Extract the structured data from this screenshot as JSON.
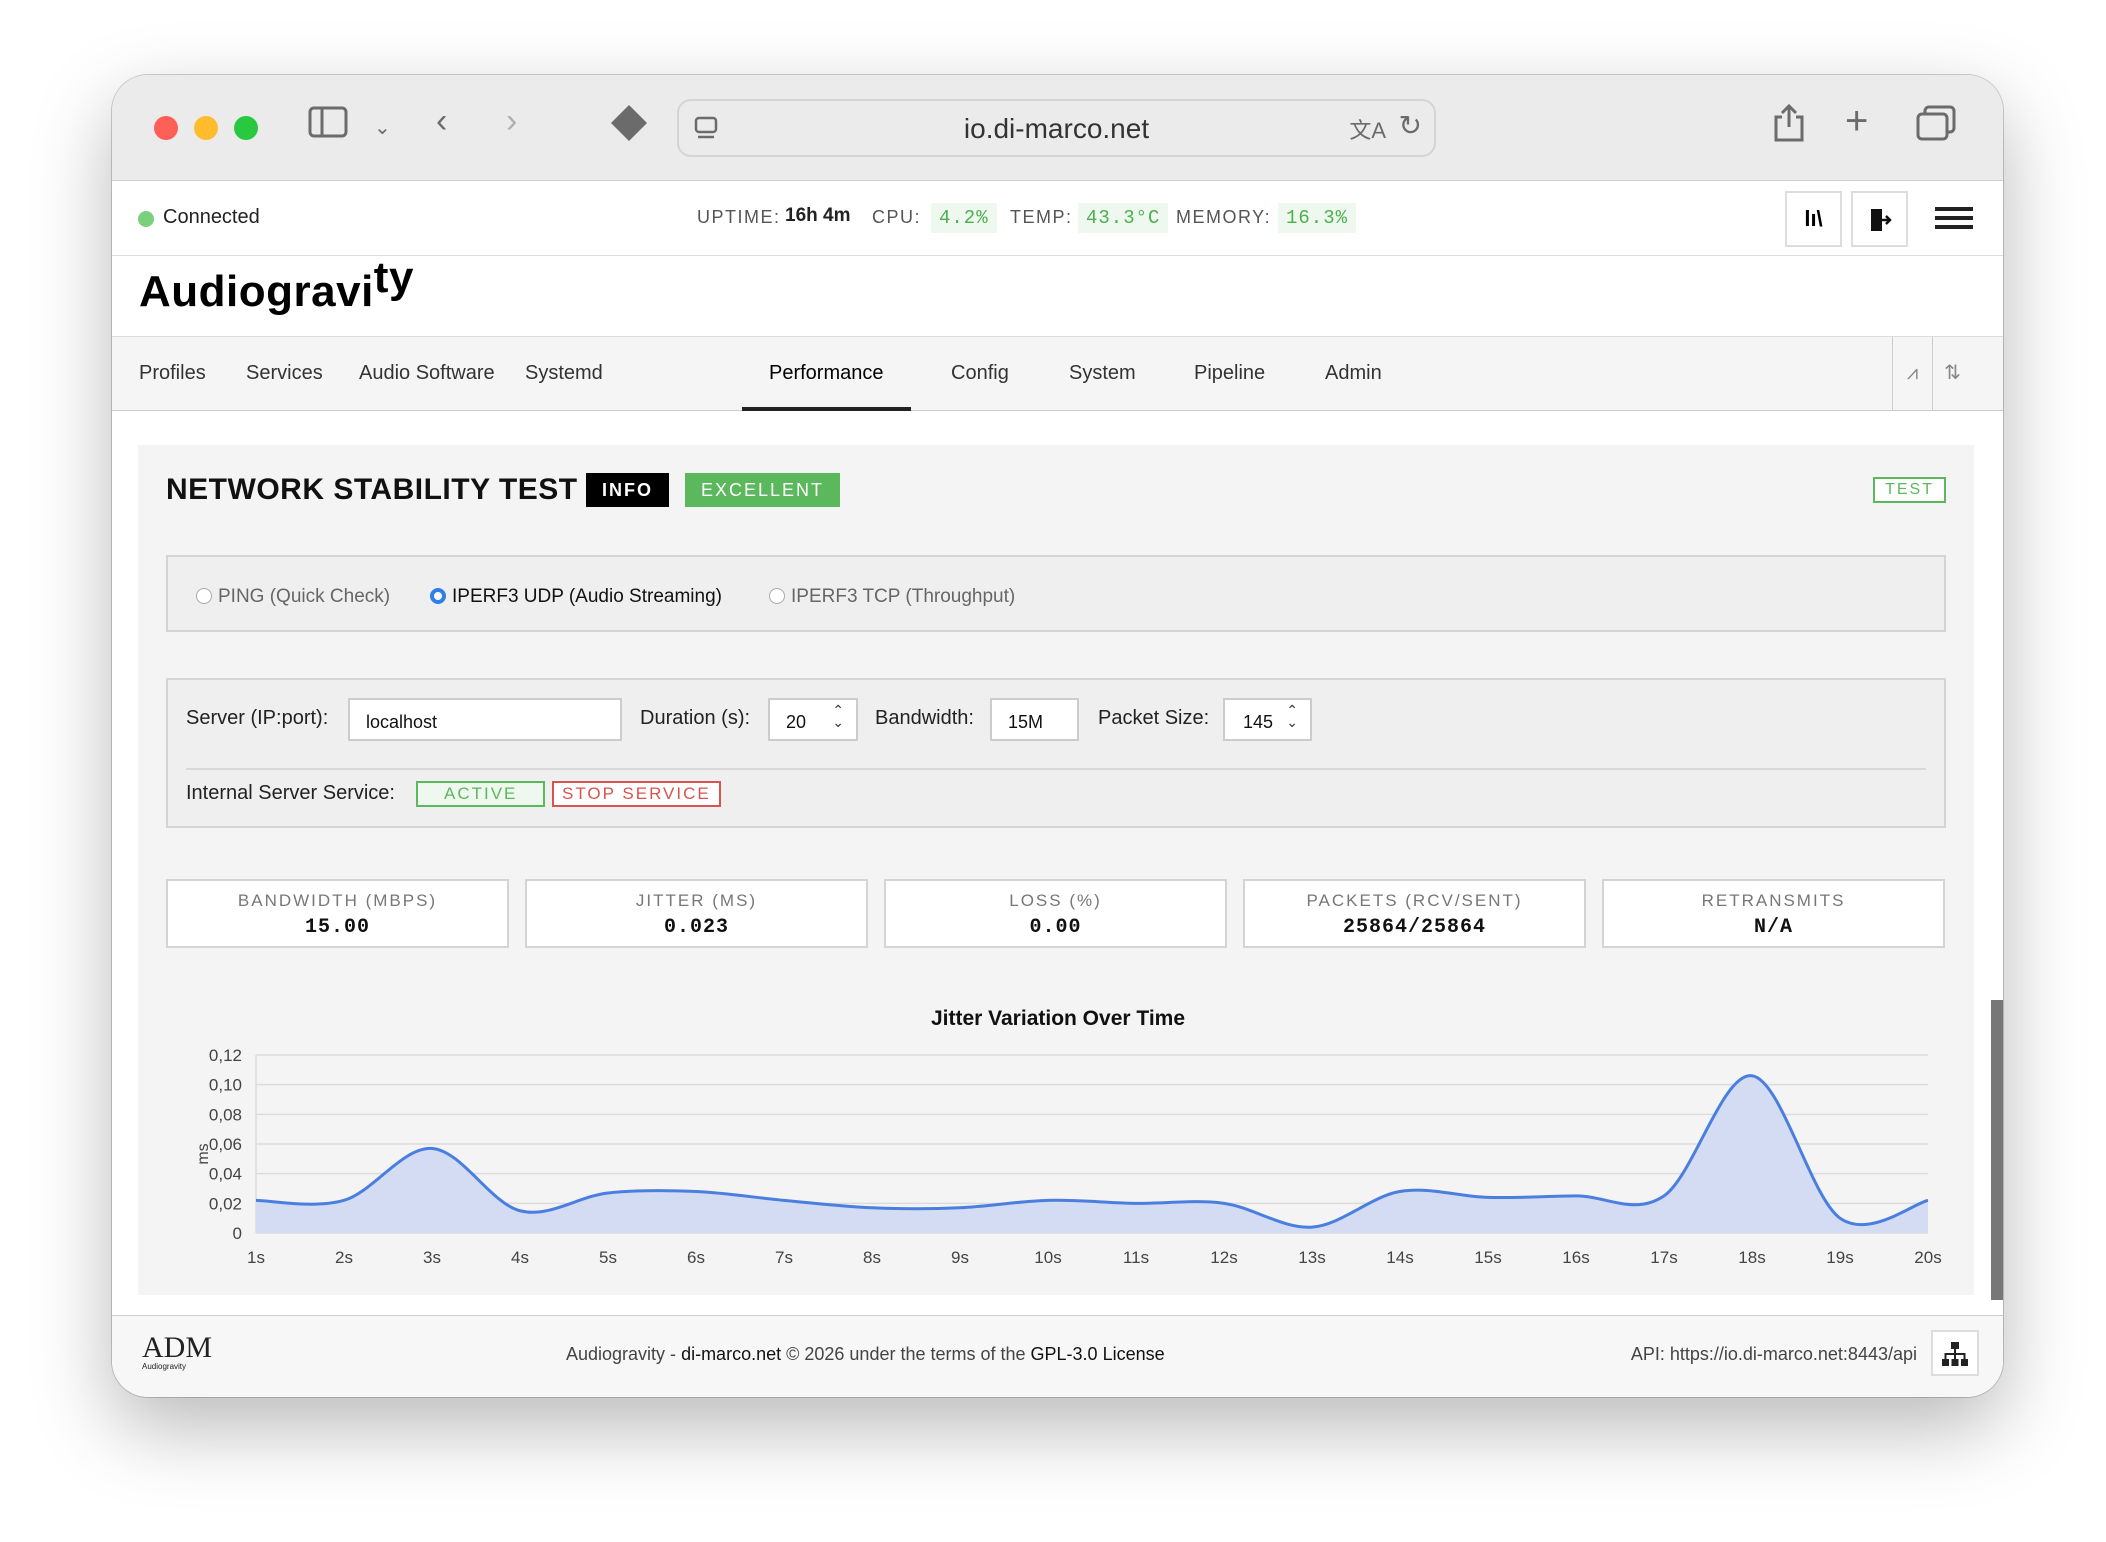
{
  "browser": {
    "url": "io.di-marco.net"
  },
  "status": {
    "connection": "Connected",
    "uptime_label": "UPTIME:",
    "uptime": "16h 4m",
    "cpu_label": "CPU:",
    "cpu": "4.2%",
    "temp_label": "TEMP:",
    "temp": "43.3°C",
    "memory_label": "MEMORY:",
    "memory": "16.3%",
    "color_ok": "#4caf50"
  },
  "brand": {
    "main": "Audiogravi",
    "sup": "ty"
  },
  "nav": {
    "tabs": [
      "Profiles",
      "Services",
      "Audio Software",
      "Systemd",
      "Performance",
      "Config",
      "System",
      "Pipeline",
      "Admin"
    ],
    "active": "Performance"
  },
  "test": {
    "title": "NETWORK STABILITY TEST",
    "info_badge": "INFO",
    "quality_badge": "EXCELLENT",
    "test_button": "TEST"
  },
  "modes": {
    "options": [
      "PING (Quick Check)",
      "IPERF3 UDP (Audio Streaming)",
      "IPERF3 TCP (Throughput)"
    ],
    "selected": "IPERF3 UDP (Audio Streaming)"
  },
  "settings": {
    "server_label": "Server (IP:port):",
    "server_value": "localhost",
    "duration_label": "Duration (s):",
    "duration_value": "20",
    "bandwidth_label": "Bandwidth:",
    "bandwidth_value": "15M",
    "packet_label": "Packet Size:",
    "packet_value": "145",
    "service_label": "Internal Server Service:",
    "service_status": "ACTIVE",
    "stop_label": "STOP SERVICE"
  },
  "metrics": [
    {
      "label": "BANDWIDTH (MBPS)",
      "value": "15.00"
    },
    {
      "label": "JITTER (MS)",
      "value": "0.023"
    },
    {
      "label": "LOSS (%)",
      "value": "0.00"
    },
    {
      "label": "PACKETS (RCV/SENT)",
      "value": "25864/25864"
    },
    {
      "label": "RETRANSMITS",
      "value": "N/A"
    }
  ],
  "chart_data": {
    "type": "area",
    "title": "Jitter Variation Over Time",
    "ylabel": "ms",
    "x": [
      "1s",
      "2s",
      "3s",
      "4s",
      "5s",
      "6s",
      "7s",
      "8s",
      "9s",
      "10s",
      "11s",
      "12s",
      "13s",
      "14s",
      "15s",
      "16s",
      "17s",
      "18s",
      "19s",
      "20s"
    ],
    "values": [
      0.022,
      0.022,
      0.057,
      0.015,
      0.027,
      0.028,
      0.022,
      0.017,
      0.017,
      0.022,
      0.02,
      0.02,
      0.004,
      0.028,
      0.024,
      0.025,
      0.025,
      0.106,
      0.01,
      0.022
    ],
    "ylim": [
      0,
      0.12
    ],
    "yticks": [
      "0",
      "0,02",
      "0,04",
      "0,06",
      "0,08",
      "0,10",
      "0,12"
    ],
    "line_color": "#4a7fe0",
    "fill_color": "#d3dcf3",
    "grid": true
  },
  "footer": {
    "logo": "ADM",
    "logo_sub": "Audiogravity",
    "text1": "Audiogravity - ",
    "link1": "di-marco.net",
    "text2": " © 2026 under the terms of the ",
    "link2": "GPL-3.0 License",
    "api": "API: https://io.di-marco.net:8443/api"
  }
}
